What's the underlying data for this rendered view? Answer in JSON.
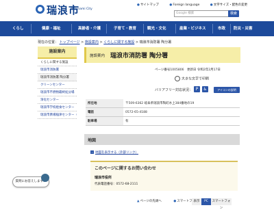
{
  "header": {
    "logo_text": "瑞浪市",
    "logo_sub": "Mizunami City",
    "links": [
      "サイトマップ",
      "Foreign language",
      "文字サイズ・配色の変更"
    ],
    "search_placeholder": "Google 検索",
    "search_button": "検索"
  },
  "nav": [
    "くらし",
    "健康・福祉",
    "高齢者・介護",
    "子育て・教育",
    "観光・文化",
    "産業・ビジネス",
    "市政",
    "防災・災害"
  ],
  "breadcrumb": {
    "prefix": "現在の位置：",
    "items": [
      "トップページ",
      "施設案内",
      "くらしに関する施設"
    ],
    "current": "瑞浪市消防署 陶分署"
  },
  "sidebar": {
    "title": "施設案内",
    "items": [
      "くらしに関する施設",
      "瑞浪市消防署",
      "瑞浪市消防署 陶分署",
      "クリーンセンター",
      "瑞浪市不燃物最終処分場",
      "浄化センター",
      "瑞浪市学校給食センター",
      "瑞浪市斎場稲津センター（ハートピア"
    ]
  },
  "main": {
    "category": "施設案内",
    "title": "瑞浪市消防署 陶分署",
    "page_id": "ページ番号1005806　更新日 令和2年2月17日",
    "print_label": "大きな文字で印刷",
    "barrier_label": "バリアフリー対応状況：",
    "app_button": "アイコンの説明"
  },
  "info_table": [
    {
      "label": "所在地",
      "value": "〒509-6362 岐阜県瑞浪市陶町水上384番地の19"
    },
    {
      "label": "電話",
      "value": "0572-65-4188"
    },
    {
      "label": "駐車場",
      "value": "有"
    }
  ],
  "map": {
    "heading": "地図",
    "link": "地図を表示する（外部リンク）"
  },
  "inquiry": {
    "title": "このページに関するお問い合わせ",
    "org": "瑞浪市役所",
    "tel": "代表電話番号：0572-68-2111"
  },
  "chat": {
    "label": "質問にお答えします！"
  },
  "footer": {
    "links": [
      "ページの先頭へ",
      "スマートフォン版"
    ],
    "switch": [
      "表示",
      "PC",
      "スマートフォン"
    ]
  }
}
